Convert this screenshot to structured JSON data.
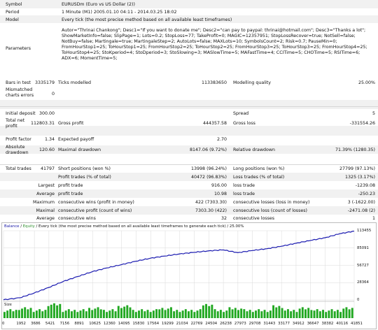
{
  "report": {
    "symbol": {
      "label": "Symbol",
      "value": "EURUSDm (Euro vs US Dollar (2))"
    },
    "period": {
      "label": "Period",
      "value": "1 Minute (M1) 2005.01.10 04:11 - 2014.03.25 18:02"
    },
    "model": {
      "label": "Model",
      "value": "Every tick (the most precise method based on all available least timeframes)"
    },
    "parameters": {
      "label": "Parameters",
      "value": "Autor=\"Thrinai Chankong\"; Desc1=\"If you want to donate me\"; Desc2=\"can pay to paypal: thrinai@hotmail.com\"; Desc3=\"Thanks a lot\"; ShowMarketInfo=false; SlipPage=1; Lots=0.2; StopLoss=77; TakeProfit=0; MAGIC=12357951; StopLossRecover=true; NotSell=false; NotBuy=false; Martingale=true; MartingaleStep=2; AutoLots=false; MAXLots=10; SymbolsCount=2; Risk=0.7; PauseMin=0; FromHourStop1=25; ToHourStop1=25; FromHourStop2=25; ToHourStop2=25; FromHourStop3=25; ToHourStop3=25; FromHourStop4=25; ToHourStop4=25; StoKperiod=4; StoDperiod=3; StoSlowing=3; MASlowTime=5; MAFastTime=4; CCITime=5; CHOTime=5; RSITime=6; ADX=6; MomentTime=5;"
    },
    "bars": {
      "label": "Bars in test",
      "value": "3335179",
      "label2": "Ticks modelled",
      "value2": "113383650",
      "label3": "Modelling quality",
      "value3": "25.00%"
    },
    "mismatched": {
      "label_line1": "Mismatched",
      "label_line2": "charts errors",
      "value": "0"
    },
    "initial_deposit": {
      "label": "Initial deposit",
      "value": "300.00",
      "label2": "Spread",
      "value2": "5"
    },
    "net_profit": {
      "label_line1": "Total net",
      "label_line2": "profit",
      "value": "112803.31",
      "label2": "Gross profit",
      "value2": "444357.58",
      "label3": "Gross loss",
      "value3": "-331554.26"
    },
    "profit_factor": {
      "label": "Profit factor",
      "value": "1.34",
      "label2": "Expected payoff",
      "value2": "2.70"
    },
    "abs_drawdown": {
      "label_line1": "Absolute",
      "label_line2": "drawdown",
      "value": "120.60",
      "label2": "Maximal drawdown",
      "value2": "8147.06 (9.72%)",
      "label3": "Relative drawdown",
      "value3": "71.39% (1280.35)"
    },
    "total_trades": {
      "label": "Total trades",
      "value": "41797",
      "label2": "Short positions (won %)",
      "value2": "13998 (96.24%)",
      "label3": "Long positions (won %)",
      "value3": "27799 (97.13%)"
    },
    "profit_trades_row": {
      "label2": "Profit trades (% of total)",
      "value2": "40472 (96.83%)",
      "label3": "Loss trades (% of total)",
      "value3": "1325 (3.17%)"
    },
    "largest": {
      "prefix": "Largest",
      "label2": "profit trade",
      "value2": "916.00",
      "label3": "loss trade",
      "value3": "-1239.08"
    },
    "average": {
      "prefix": "Average",
      "label2": "profit trade",
      "value2": "10.98",
      "label3": "loss trade",
      "value3": "-250.23"
    },
    "max_consec_money": {
      "prefix": "Maximum",
      "label2": "consecutive wins (profit in money)",
      "value2": "422 (7303.30)",
      "label3": "consecutive losses (loss in money)",
      "value3": "3 (-1622.00)"
    },
    "max_consec_count": {
      "prefix": "Maximal",
      "label2": "consecutive profit (count of wins)",
      "value2": "7303.30 (422)",
      "label3": "consecutive loss (count of losses)",
      "value3": "-2471.08 (2)"
    },
    "avg_consec": {
      "prefix": "Average",
      "label2": "consecutive wins",
      "value2": "32",
      "label3": "consecutive losses",
      "value3": "1"
    }
  },
  "chart": {
    "title_balance": "Balance",
    "title_sep1": " / ",
    "title_equity": "Equity",
    "title_rest": " / Every tick (the most precise method based on all available least timeframes to generate each tick) / 25.00%",
    "size_label": "Size",
    "colors": {
      "balance": "#1a1ab0",
      "equity": "#2e9e2e",
      "size": "#22a822",
      "grid": "#d9d9d9"
    }
  },
  "chart_data": {
    "type": "line",
    "title": "Balance / Equity / Every tick (the most precise method based on all available least timeframes to generate each tick) / 25.00%",
    "x_ticks": [
      "0",
      "1952",
      "3686",
      "5421",
      "7156",
      "8891",
      "10625",
      "12360",
      "14095",
      "15830",
      "17564",
      "19299",
      "21034",
      "22769",
      "24504",
      "26238",
      "27973",
      "29708",
      "31443",
      "33177",
      "34912",
      "36647",
      "38382",
      "40116",
      "41851"
    ],
    "y_ticks": [
      "113455",
      "85091",
      "56727",
      "28364",
      "0"
    ],
    "ylim": [
      0,
      113455
    ],
    "xlim": [
      0,
      41851
    ],
    "series": [
      {
        "name": "Balance",
        "x": [
          0,
          1952,
          3686,
          5421,
          7156,
          8891,
          10625,
          12360,
          14095,
          15830,
          17564,
          19299,
          21034,
          22769,
          24504,
          26238,
          27973,
          29708,
          31443,
          33177,
          34912,
          36647,
          38382,
          40116,
          41851
        ],
        "values": [
          300,
          3500,
          11500,
          20500,
          30500,
          38500,
          46500,
          52500,
          58000,
          63500,
          68500,
          72000,
          75500,
          78000,
          80500,
          82000,
          77500,
          81000,
          84000,
          88000,
          93000,
          97500,
          102000,
          108500,
          112803
        ]
      },
      {
        "name": "Size",
        "note_type": "bar",
        "values": [
          0.2,
          0.4,
          0.2,
          0.8,
          0.2,
          0.2,
          0.4,
          0.2,
          0.6,
          0.2,
          0.2,
          0.4,
          0.2,
          0.2,
          0.8,
          0.2,
          0.4,
          0.2,
          0.2,
          0.6,
          0.2,
          0.4,
          0.2,
          0.2,
          0.4
        ]
      }
    ]
  }
}
